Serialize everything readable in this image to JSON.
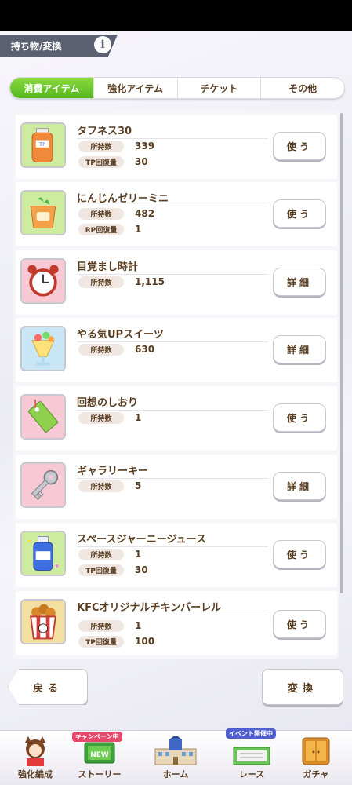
{
  "header": {
    "title": "持ち物/変換",
    "info_glyph": "i"
  },
  "tabs": [
    {
      "label": "消費アイテム",
      "active": true
    },
    {
      "label": "強化アイテム",
      "active": false
    },
    {
      "label": "チケット",
      "active": false
    },
    {
      "label": "その他",
      "active": false
    }
  ],
  "items": [
    {
      "name": "タフネス30",
      "icon": "tp-bottle-icon",
      "rows": [
        {
          "label": "所持数",
          "value": "339"
        },
        {
          "label": "TP回復量",
          "value": "30"
        }
      ],
      "button": "使う"
    },
    {
      "name": "にんじんゼリーミニ",
      "icon": "carrot-jelly-icon",
      "rows": [
        {
          "label": "所持数",
          "value": "482"
        },
        {
          "label": "RP回復量",
          "value": "1"
        }
      ],
      "button": "使う"
    },
    {
      "name": "目覚まし時計",
      "icon": "alarm-clock-icon",
      "rows": [
        {
          "label": "所持数",
          "value": "1,115"
        }
      ],
      "button": "詳細"
    },
    {
      "name": "やる気UPスイーツ",
      "icon": "parfait-icon",
      "rows": [
        {
          "label": "所持数",
          "value": "630"
        }
      ],
      "button": "詳細"
    },
    {
      "name": "回想のしおり",
      "icon": "bookmark-icon",
      "rows": [
        {
          "label": "所持数",
          "value": "1"
        }
      ],
      "button": "使う"
    },
    {
      "name": "ギャラリーキー",
      "icon": "key-icon",
      "rows": [
        {
          "label": "所持数",
          "value": "5"
        }
      ],
      "button": "詳細"
    },
    {
      "name": "スペースジャーニージュース",
      "icon": "juice-bottle-icon",
      "rows": [
        {
          "label": "所持数",
          "value": "1"
        },
        {
          "label": "TP回復量",
          "value": "30"
        }
      ],
      "button": "使う"
    },
    {
      "name": "KFCオリジナルチキンバーレル",
      "icon": "chicken-bucket-icon",
      "rows": [
        {
          "label": "所持数",
          "value": "1"
        },
        {
          "label": "TP回復量",
          "value": "100"
        }
      ],
      "button": "使う"
    }
  ],
  "footer": {
    "back_label": "戻る",
    "convert_label": "変換"
  },
  "nav": [
    {
      "label": "強化編成"
    },
    {
      "label": "ストーリー",
      "badge": "キャンペーン中"
    },
    {
      "label": "ホーム"
    },
    {
      "label": "レース",
      "badge": "イベント開催中"
    },
    {
      "label": "ガチャ"
    }
  ],
  "colors": {
    "tab_active": "#56b71e",
    "text": "#5a3e22",
    "header_bg": "#5b6170"
  }
}
